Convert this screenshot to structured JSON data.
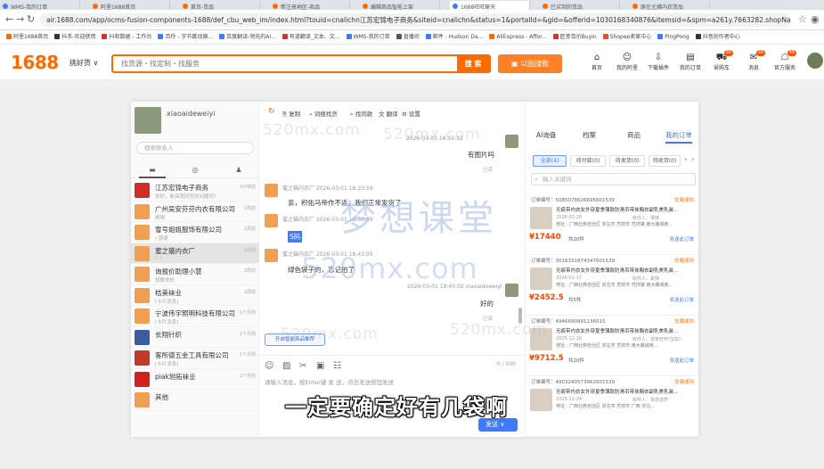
{
  "browser": {
    "tabs": [
      {
        "label": "WMS-我的订单",
        "color": "#3e7bfa"
      },
      {
        "label": "阿里1688首页",
        "color": "#ff6a00"
      },
      {
        "label": "首页-货品",
        "color": "#ff6a00"
      },
      {
        "label": "帮注册地区-商品",
        "color": "#ff6a00"
      },
      {
        "label": "编辑商品智能上架",
        "color": "#ff6a00"
      },
      {
        "label": "1688旺旺聊天",
        "color": "#3e7bfa"
      },
      {
        "label": "已买到的货品",
        "color": "#ff6a00"
      },
      {
        "label": "原在尤拂内衣货品",
        "color": "#ff6a00"
      }
    ],
    "url": "air.1688.com/app/ocms-fusion-components-1688/def_cbu_web_im/index.html?touid=cnalichn江苏宏锦电子商务&siteid=cnalichn&status=1&portalId=&gid=&offerid=1030168340876&itemsid=&spm=a261y.7663282.shopNavigation.l...",
    "bookmarks": [
      {
        "label": "阿里1688首页",
        "color": "#ff6a00"
      },
      {
        "label": "抖手-欢迎使用",
        "color": "#333333"
      },
      {
        "label": "抖和数据 - 工作台",
        "color": "#d0342c"
      },
      {
        "label": "百伶 - 字节跳动旗...",
        "color": "#3e7bfa"
      },
      {
        "label": "百度翻译-领先的AI...",
        "color": "#3e7bfa"
      },
      {
        "label": "有道翻译_文本、文...",
        "color": "#d0342c"
      },
      {
        "label": "WMS-我的订单",
        "color": "#3e7bfa"
      },
      {
        "label": "直播间",
        "color": "#555555"
      },
      {
        "label": "邮件 - Hudson Da...",
        "color": "#3e7bfa"
      },
      {
        "label": "AliExpress - Affor...",
        "color": "#ff6a00"
      },
      {
        "label": "匠意百价Buyin",
        "color": "#d0342c"
      },
      {
        "label": "Shopee卖家中心",
        "color": "#ee4d2d"
      },
      {
        "label": "PingPong",
        "color": "#3e7bfa"
      },
      {
        "label": "抖音创作者中心",
        "color": "#333333"
      }
    ]
  },
  "site": {
    "logo": "1688",
    "category": "挑好货 ∨",
    "search_placeholder": "找货源・找定制・找服务",
    "search_button": "搜 索",
    "image_search": "以图搜款",
    "nav": [
      {
        "label": "首页",
        "icon": "⌂",
        "badge": ""
      },
      {
        "label": "我的阿里",
        "icon": "☺",
        "badge": ""
      },
      {
        "label": "下载插件",
        "icon": "⇩",
        "badge": ""
      },
      {
        "label": "我的订单",
        "icon": "▤",
        "badge": ""
      },
      {
        "label": "采购车",
        "icon": "⛟",
        "badge": "99"
      },
      {
        "label": "消息",
        "icon": "✉",
        "badge": "99"
      },
      {
        "label": "官方服务",
        "icon": "☖",
        "badge": "99"
      }
    ]
  },
  "chat": {
    "me_name": "xiaoaideweiyi",
    "contact_search_placeholder": "搜索联系人",
    "contact_tabs": [
      "▬",
      "◎",
      "♟"
    ],
    "contacts": [
      {
        "name": "江苏宏锦电子商务",
        "snippet": "你好，能探我回答的问题吗？",
        "time": "3分钟前",
        "color": "#d12c2c",
        "selected": false
      },
      {
        "name": "广州吴安芬芬内衣有限公司",
        "snippet": "嗯嗯",
        "time": "1周前",
        "color": "#f0a050",
        "selected": false
      },
      {
        "name": "雪号姐姐服饰有限公司",
        "snippet": "/ 感谢",
        "time": "1周前",
        "color": "#f0a050",
        "selected": false
      },
      {
        "name": "蜜之猫内衣厂",
        "snippet": "/:-)",
        "time": "1周前",
        "color": "#f0a050",
        "selected": true
      },
      {
        "name": "询报价助理小慧",
        "snippet": "我要求的",
        "time": "2周前",
        "color": "#f0a050",
        "selected": false
      },
      {
        "name": "桔美袜业",
        "snippet": "[卡片消息]",
        "time": "2周前",
        "color": "#f0a050",
        "selected": false
      },
      {
        "name": "宁波伟宇照明科技有限公司",
        "snippet": "[卡片消息]",
        "time": "1个月前",
        "color": "#f0a050",
        "selected": false
      },
      {
        "name": "长翔针织",
        "snippet": "",
        "time": "1个月前",
        "color": "#3b5aa0",
        "selected": false
      },
      {
        "name": "客所德五金工具有限公司",
        "snippet": "[卡片消息]",
        "time": "1个月前",
        "color": "#c23a2a",
        "selected": false
      },
      {
        "name": "piak旭拓袜业",
        "snippet": "",
        "time": "2个月前",
        "color": "#d02020",
        "selected": false
      },
      {
        "name": "其他",
        "snippet": "",
        "time": "",
        "color": "#f0a050",
        "selected": false
      }
    ],
    "toolbar": [
      {
        "icon": "⎘",
        "label": "复制"
      },
      {
        "icon": "⌕",
        "label": "词搜找货"
      },
      {
        "icon": "⌕",
        "label": "找同款"
      },
      {
        "icon": "文",
        "label": "翻译"
      },
      {
        "icon": "⚙",
        "label": "设置"
      }
    ],
    "messages": {
      "m1_time": "2026-03-01 18:33:32",
      "m1_sender": "xiaoaideweiyi",
      "m1_text": "有图片吗",
      "m1_read": "已读",
      "m2_sender": "蜜之猫内衣厂",
      "m2_time": "2026-03-01 18:33:59",
      "m2_text": "亲，积佑马帝作不返，我们正常发货了",
      "m3_sender": "蜜之猫内衣厂",
      "m3_time": "2026-03-01 18:39:59",
      "m3_text": "S码",
      "m4_sender": "蜜之猫内衣厂",
      "m4_time": "2026-03-01 18:41:05",
      "m4_text": "绿色袋子的，忘记拍了",
      "m5_time": "2026-03-01 18:40:02",
      "m5_sender": "xiaoaideweiyi",
      "m5_text": "好的",
      "m5_read": "已读"
    },
    "smart_button": "开启智能商品推荐",
    "composer_icons": [
      "☺",
      "▨",
      "✂",
      "▣",
      "☷"
    ],
    "counter": "0 / 500",
    "input_placeholder": "请输入消息，按Enter键 发 送，点击发送按钮发送",
    "send_button": "发送 ∨"
  },
  "orders": {
    "tabs": [
      "AI询盘",
      "档案",
      "商品",
      "我的订单"
    ],
    "filters": [
      "全部(4)",
      "待付款(0)",
      "待发货(0)",
      "待收货(0)"
    ],
    "search_placeholder": "输入关键词",
    "cards": [
      {
        "id": "订单编号：5085078626695601539",
        "status": "交易成功",
        "title": "无痕带内衣女外穿夏季薄款防滑吊带抹胸衣副乳美乳装...",
        "date": "2026-02-26",
        "receiver": "收件人：梁妹",
        "addr": "地址：广西壮族自治区 崇左市 凭祥市 凭祥镇 南大路城南...",
        "price": "¥17440",
        "qty": "共20件",
        "link": "发送此订单"
      },
      {
        "id": "订单编号：3016331874347601539",
        "status": "交易成功",
        "title": "无痕带内衣女外穿夏季薄款防滑吊带抹胸衣副乳美乳装...",
        "date": "2026-01-17",
        "receiver": "收件人：蒙妹",
        "addr": "地址：广西壮族自治区 崇左市 凭祥市 凭祥镇 南大路城南...",
        "price": "¥2452.5",
        "qty": "共5件",
        "link": "发送此订单"
      },
      {
        "id": "订单编号：4946690891136015",
        "status": "交易成功",
        "title": "无痕带内衣女外穿夏季薄款防滑吊带抹胸衣副乳美乳装...",
        "date": "2025-12-16",
        "receiver": "收件人：曾有旺轩(宝如)",
        "addr": "地址：广西壮族自治区 崇左市 凭祥市 南大路城南...",
        "price": "¥9712.5",
        "qty": "共20件",
        "link": "发送此订单"
      },
      {
        "id": "订单编号：4903240573962601539",
        "status": "交易成功",
        "title": "无痕带内衣女外穿夏季薄款防滑吊带抹胸衣副乳美乳装...",
        "date": "2025-11-24",
        "receiver": "收件人：朱技滚梦",
        "addr": "地址：广西壮族自治区 崇左市 凭祥市 广西 崇左...",
        "price": "",
        "qty": "",
        "link": ""
      }
    ]
  },
  "watermarks": [
    "520mx.com",
    "梦想课堂"
  ],
  "subtitle": "一定要确定好有几袋啊"
}
